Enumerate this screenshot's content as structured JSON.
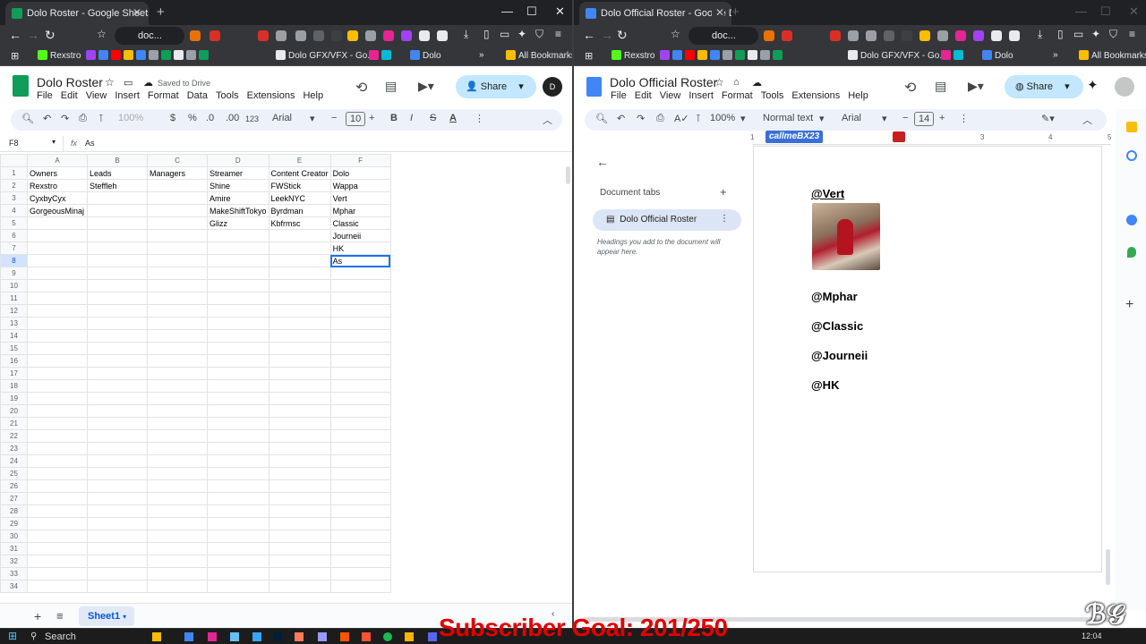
{
  "left_window": {
    "tab_title": "Dolo Roster - Google Sheets",
    "omnibox": "doc...",
    "bookmarks": [
      "Rexstro",
      "Dolo GFX/VFX - Go...",
      "Dolo"
    ],
    "all_bookmarks": "All Bookmarks",
    "app": {
      "title": "Dolo Roster",
      "saved_status": "Saved to Drive",
      "menus": [
        "File",
        "Edit",
        "View",
        "Insert",
        "Format",
        "Data",
        "Tools",
        "Extensions",
        "Help"
      ],
      "share_label": "Share",
      "toolbar": {
        "zoom": "100%",
        "currency": "$",
        "percent": "%",
        "dec_less": ".0",
        "dec_more": ".00",
        "number_format": "123",
        "font": "Arial",
        "font_size": "10",
        "bold": "B",
        "italic": "I",
        "strike": "S",
        "text_color": "A"
      },
      "name_box": "F8",
      "formula_value": "As",
      "columns": [
        "A",
        "B",
        "C",
        "D",
        "E",
        "F"
      ],
      "rows": [
        [
          "Owners",
          "Leads",
          "Managers",
          "Streamer",
          "Content Creator",
          "Dolo"
        ],
        [
          "Rexstro",
          "Steffleh",
          "",
          "Shine",
          "FWStick",
          "Wappa"
        ],
        [
          "CyxbyCyx",
          "",
          "",
          "Amire",
          "LeekNYC",
          "Vert"
        ],
        [
          "GorgeousMinaj",
          "",
          "",
          "MakeShiftTokyo",
          "Byrdman",
          "Mphar"
        ],
        [
          "",
          "",
          "",
          "Glizz",
          "Kbfrmsc",
          "Classic"
        ],
        [
          "",
          "",
          "",
          "",
          "",
          "Journeii"
        ],
        [
          "",
          "",
          "",
          "",
          "",
          "HK"
        ],
        [
          "",
          "",
          "",
          "",
          "",
          "As"
        ]
      ],
      "row_numbers": [
        "1",
        "2",
        "3",
        "4",
        "5",
        "6",
        "7",
        "8",
        "9",
        "10",
        "11",
        "12",
        "13",
        "14",
        "15",
        "16",
        "17",
        "18",
        "19",
        "20",
        "21",
        "22",
        "23",
        "24",
        "25",
        "26",
        "27",
        "28",
        "29",
        "30",
        "31",
        "32",
        "33",
        "34"
      ],
      "sheet_tab": "Sheet1"
    }
  },
  "right_window": {
    "tab_title": "Dolo Official Roster - Google Do",
    "omnibox": "doc...",
    "bookmarks": [
      "Rexstro",
      "Dolo GFX/VFX - Go...",
      "Dolo"
    ],
    "all_bookmarks": "All Bookmarks",
    "app": {
      "title": "Dolo Official Roster",
      "menus": [
        "File",
        "Edit",
        "View",
        "Insert",
        "Format",
        "Tools",
        "Extensions",
        "Help"
      ],
      "share_label": "Share",
      "toolbar": {
        "zoom": "100%",
        "style": "Normal text",
        "font": "Arial",
        "font_size": "14"
      },
      "ruler_overlay": "callmeBX23",
      "ruler_ticks": [
        "1",
        "2",
        "3",
        "4",
        "5"
      ],
      "document_tabs_label": "Document tabs",
      "doc_tab_name": "Dolo Official Roster",
      "outline_hint": "Headings you add to the document will appear here.",
      "mentions": [
        "@Vert",
        "@Mphar",
        "@Classic",
        "@Journeii",
        "@HK"
      ]
    }
  },
  "taskbar": {
    "search": "Search",
    "clock": "12:04"
  },
  "overlay_text": "Subscriber Goal: 201/250",
  "colors": {
    "sheets_green": "#0f9d58",
    "docs_blue": "#4285f4",
    "overlay_red": "#e00000",
    "selection_blue": "#1a73e8"
  }
}
